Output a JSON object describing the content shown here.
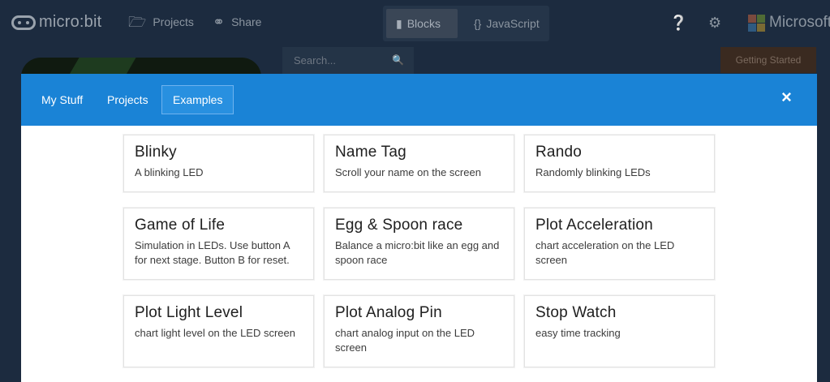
{
  "topbar": {
    "logo_text": "micro:bit",
    "projects_label": "Projects",
    "share_label": "Share",
    "editor_toggle": {
      "blocks_label": "Blocks",
      "javascript_label": "JavaScript",
      "selected": "Blocks"
    },
    "microsoft_label": "Microsoft",
    "microsoft_colors": [
      "#7a4a3e",
      "#4f6b35",
      "#2f5a80",
      "#7a6a34"
    ]
  },
  "behind": {
    "search_placeholder": "Search...",
    "getting_started_label": "Getting Started"
  },
  "modal": {
    "tabs": [
      {
        "label": "My Stuff"
      },
      {
        "label": "Projects"
      },
      {
        "label": "Examples",
        "selected": true
      }
    ],
    "close_icon": "×",
    "cards": [
      {
        "title": "Blinky",
        "description": "A blinking LED"
      },
      {
        "title": "Name Tag",
        "description": "Scroll your name on the screen"
      },
      {
        "title": "Rando",
        "description": "Randomly blinking LEDs"
      },
      {
        "title": "Game of Life",
        "description": "Simulation in LEDs. Use button A for next stage. Button B for reset."
      },
      {
        "title": "Egg & Spoon race",
        "description": "Balance a micro:bit like an egg and spoon race"
      },
      {
        "title": "Plot Acceleration",
        "description": "chart acceleration on the LED screen"
      },
      {
        "title": "Plot Light Level",
        "description": "chart light level on the LED screen"
      },
      {
        "title": "Plot Analog Pin",
        "description": "chart analog input on the LED screen"
      },
      {
        "title": "Stop Watch",
        "description": "easy time tracking"
      }
    ]
  },
  "colors": {
    "header_blue": "#1a83d6",
    "topbar": "#1c2b3f"
  }
}
